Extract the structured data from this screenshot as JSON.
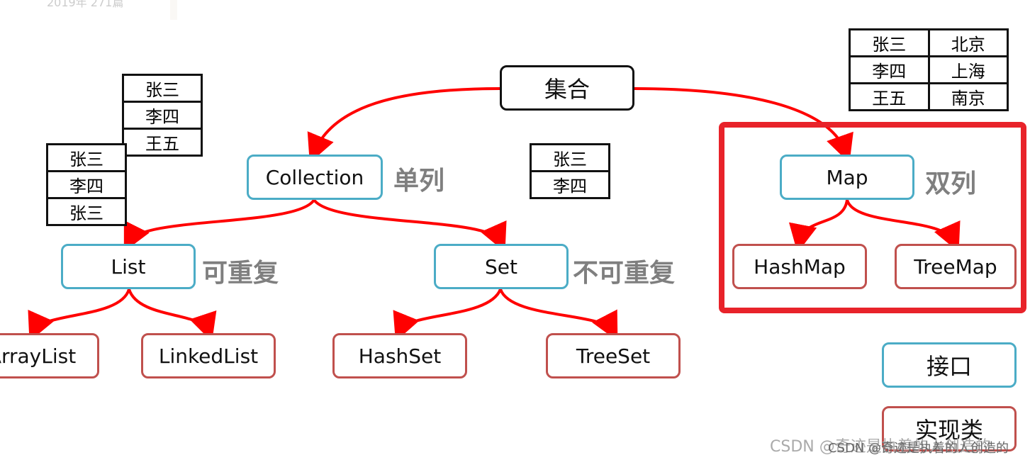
{
  "header_fragment": "2019年 271篇",
  "root": "集合",
  "interfaces": {
    "collection": "Collection",
    "map": "Map",
    "list": "List",
    "set": "Set"
  },
  "implementations": {
    "arraylist": "ArrayList",
    "linkedlist": "LinkedList",
    "hashset": "HashSet",
    "treeset": "TreeSet",
    "hashmap": "HashMap",
    "treemap": "TreeMap"
  },
  "notes": {
    "single": "单列",
    "double": "双列",
    "repeatable": "可重复",
    "non_repeatable": "不可重复"
  },
  "legend": {
    "interface": "接口",
    "implementation": "实现类"
  },
  "tables": {
    "list_a": [
      "张三",
      "李四",
      "王五"
    ],
    "list_b": [
      "张三",
      "李四",
      "张三"
    ],
    "set": [
      "张三",
      "李四"
    ],
    "map": [
      [
        "张三",
        "北京"
      ],
      [
        "李四",
        "上海"
      ],
      [
        "王五",
        "南京"
      ]
    ]
  },
  "watermark": "CSDN @奇迹是执着的人创造的",
  "colors": {
    "interface": "#4bacc6",
    "implementation": "#c0504d",
    "arrow": "#ff0000",
    "highlight": "#e8232a",
    "note": "#7f7f7f"
  }
}
